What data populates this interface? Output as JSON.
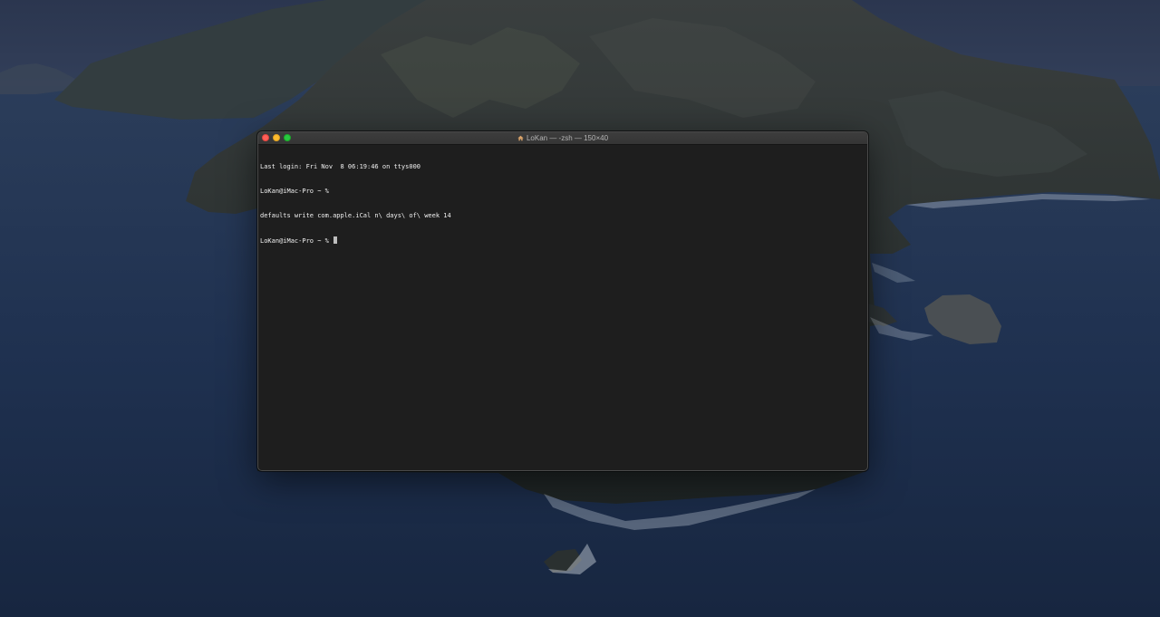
{
  "terminal": {
    "title": "LoKan — -zsh — 150×40",
    "title_icon": "home-icon",
    "lines": [
      "Last login: Fri Nov  8 06:19:46 on ttys000",
      "LoKan@iMac-Pro ~ %",
      "defaults write com.apple.iCal n\\ days\\ of\\ week 14",
      "LoKan@iMac-Pro ~ % "
    ],
    "colors": {
      "background": "#1e1e1e",
      "text": "#f0f0f0",
      "close": "#fe5f57",
      "minimize": "#febc2e",
      "zoom": "#28c840"
    }
  }
}
